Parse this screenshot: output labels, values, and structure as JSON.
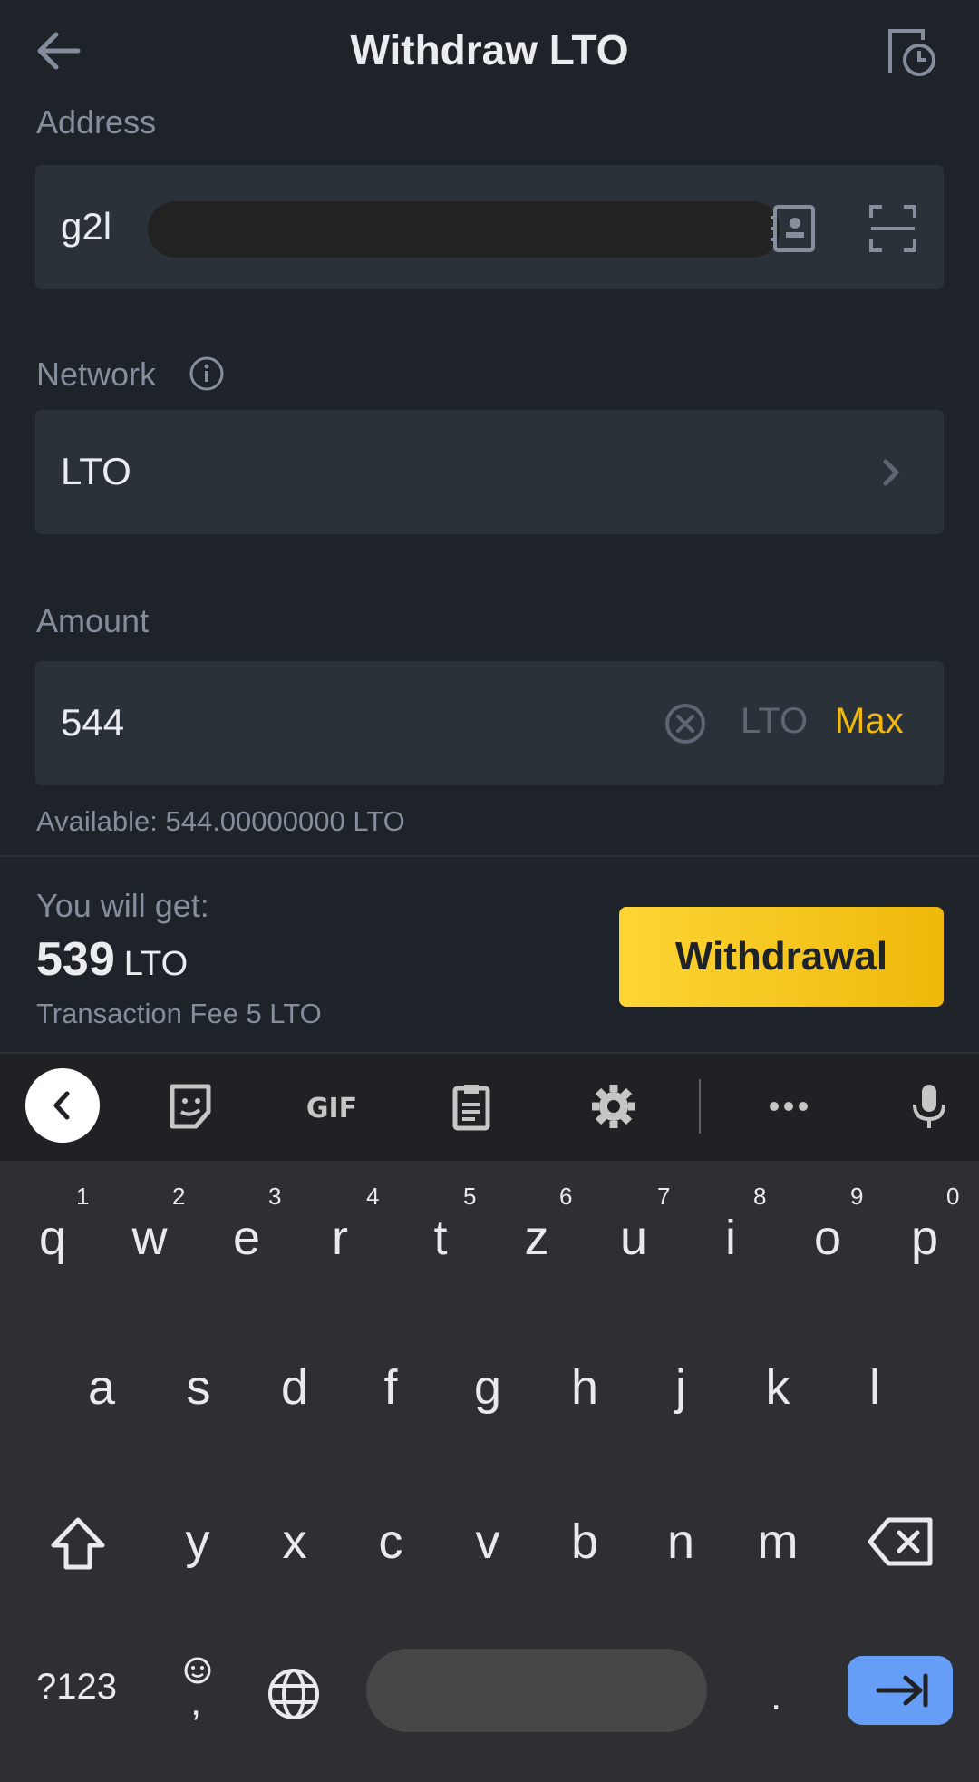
{
  "header": {
    "title": "Withdraw LTO",
    "back_icon": "arrow-left-icon",
    "history_icon": "history-icon"
  },
  "address": {
    "label": "Address",
    "value_visible": "g2l"
  },
  "network": {
    "label": "Network",
    "value": "LTO"
  },
  "amount": {
    "label": "Amount",
    "value": "544",
    "unit": "LTO",
    "max_label": "Max"
  },
  "available": "Available: 544.00000000 LTO",
  "summary": {
    "get_label": "You will get:",
    "get_value": "539",
    "get_unit": "LTO",
    "fee_text": "Transaction Fee  5 LTO"
  },
  "withdraw_button": "Withdrawal",
  "colors": {
    "accent": "#f0b90b",
    "background": "#1e2329",
    "field": "#2b3139"
  },
  "keyboard": {
    "row1": [
      "q",
      "w",
      "e",
      "r",
      "t",
      "z",
      "u",
      "i",
      "o",
      "p"
    ],
    "row1_hints": [
      "1",
      "2",
      "3",
      "4",
      "5",
      "6",
      "7",
      "8",
      "9",
      "0"
    ],
    "row2": [
      "a",
      "s",
      "d",
      "f",
      "g",
      "h",
      "j",
      "k",
      "l"
    ],
    "row3": [
      "y",
      "x",
      "c",
      "v",
      "b",
      "n",
      "m"
    ],
    "symbols_label": "?123",
    "comma": ",",
    "period": "."
  }
}
